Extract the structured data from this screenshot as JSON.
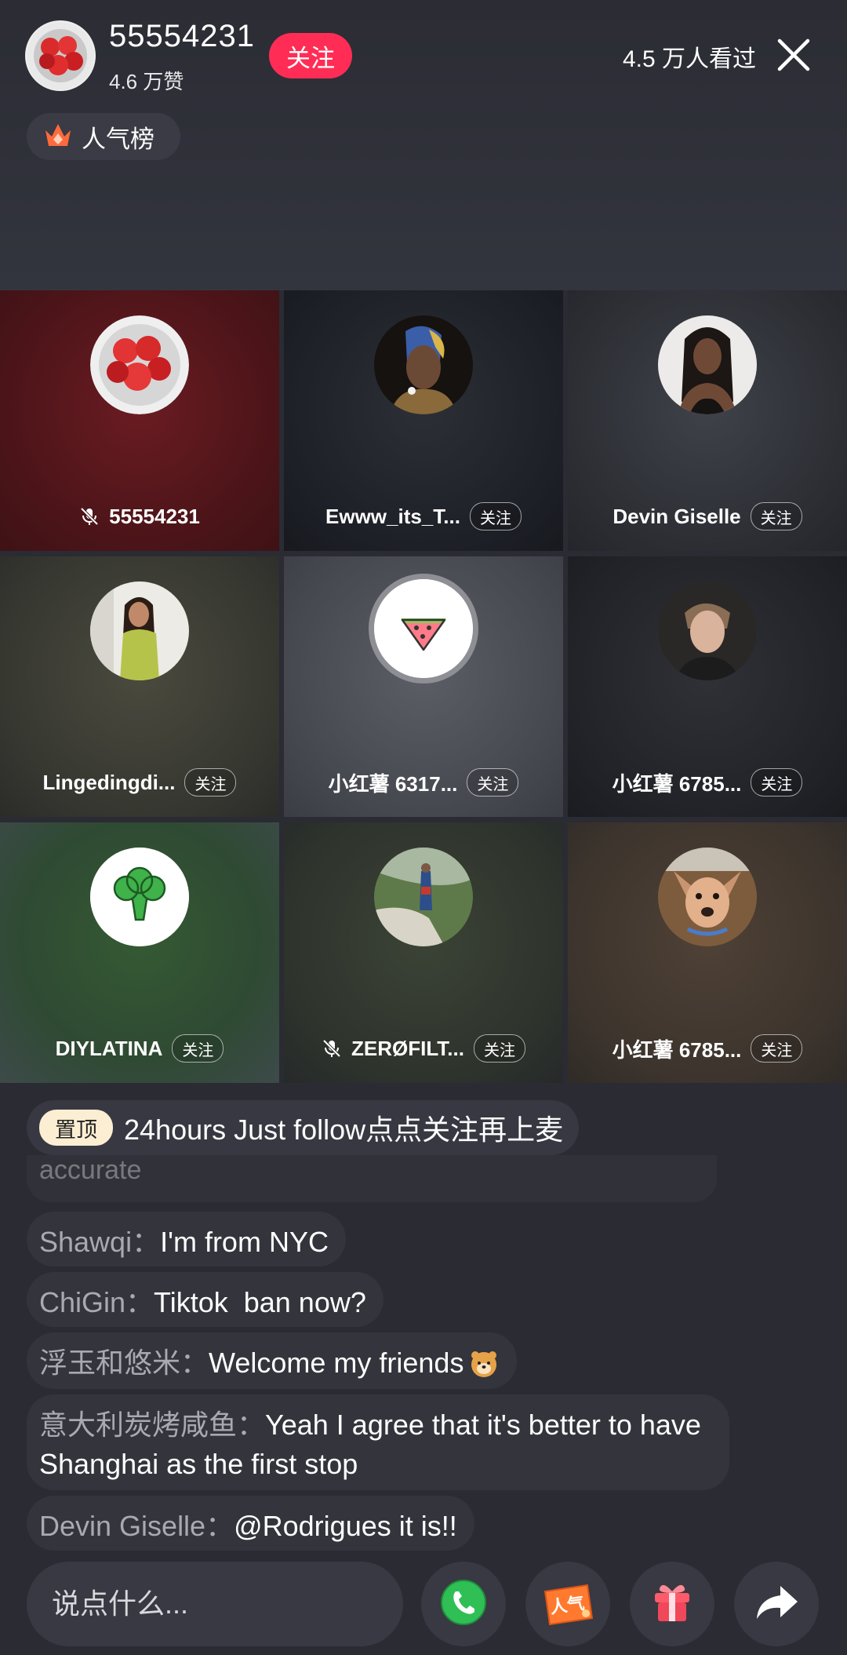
{
  "header": {
    "username": "55554231",
    "likes": "4.6 万赞",
    "follow_label": "关注",
    "viewers": "4.5 万人看过"
  },
  "rank": {
    "label": "人气榜"
  },
  "tiles": [
    {
      "name": "55554231",
      "follow": "",
      "muted": true,
      "picture": "strawberries"
    },
    {
      "name": "Ewww_its_T...",
      "follow": "关注",
      "muted": false,
      "picture": "pearl-earring-parody"
    },
    {
      "name": "Devin Giselle",
      "follow": "关注",
      "muted": false,
      "picture": "woman-portrait"
    },
    {
      "name": "Lingedingdi...",
      "follow": "关注",
      "muted": false,
      "picture": "woman-mirror-selfie"
    },
    {
      "name": "小红薯 6317...",
      "follow": "关注",
      "muted": false,
      "picture": "watermelon-icon"
    },
    {
      "name": "小红薯 6785...",
      "follow": "关注",
      "muted": false,
      "picture": "young-man"
    },
    {
      "name": "DIYLATINA",
      "follow": "关注",
      "muted": false,
      "picture": "broccoli-icon"
    },
    {
      "name": "ZERØFILT...",
      "follow": "关注",
      "muted": true,
      "picture": "mountain-path"
    },
    {
      "name": "小红薯 6785...",
      "follow": "关注",
      "muted": false,
      "picture": "dog"
    }
  ],
  "chat": {
    "pinned_tag": "置顶",
    "pinned_text": "24hours Just follow点点关注再上麦",
    "faded_text": "accurate",
    "messages": [
      {
        "user": "Shawqi：",
        "text": "I'm from NYC"
      },
      {
        "user": "ChiGin：",
        "text": "Tiktok  ban now?"
      },
      {
        "user": "浮玉和悠米：",
        "text": "Welcome my friends"
      },
      {
        "user": "意大利炭烤咸鱼：",
        "text": "Yeah I agree that it's better to have Shanghai as the first stop"
      },
      {
        "user": "Devin Giselle：",
        "text": "@Rodrigues it is!!"
      }
    ]
  },
  "input": {
    "placeholder": "说点什么..."
  },
  "buttons": {
    "popularity_label": "人气"
  },
  "colors": {
    "accent": "#ff2d55",
    "background": "#2a2b33",
    "bubble": "#33343c",
    "call_green": "#2fbf55",
    "gift_red": "#f0475a"
  }
}
